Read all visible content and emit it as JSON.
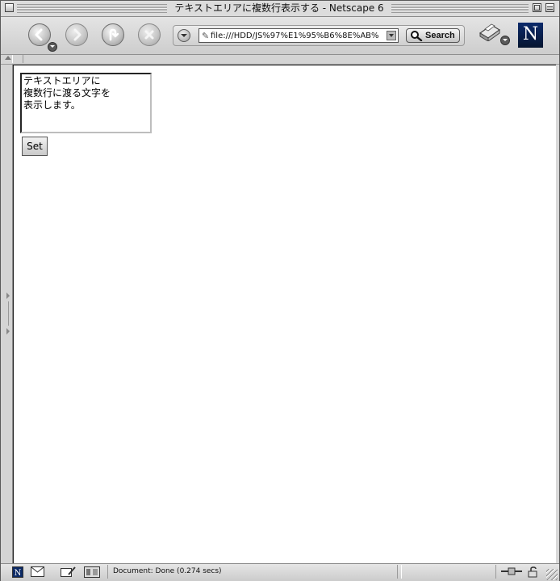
{
  "window": {
    "title": "テキストエリアに複数行表示する - Netscape 6"
  },
  "toolbar": {
    "url_value": "file:///HDD/JS%97%E1%95%B6%8E%AB%",
    "search_label": "Search"
  },
  "logo": {
    "letter": "N"
  },
  "page": {
    "textarea_value": "テキストエリアに\n複数行に渡る文字を\n表示します。",
    "set_button_label": "Set"
  },
  "statusbar": {
    "status_text": "Document: Done (0.274 secs)"
  },
  "icons": {
    "back": "back-arrow-icon",
    "forward": "forward-arrow-icon",
    "reload": "reload-icon",
    "stop": "stop-icon",
    "history": "chevron-down-icon",
    "page": "page-icon",
    "search": "magnifier-icon",
    "print": "print-icon",
    "mail": "mail-icon",
    "composer": "composer-icon",
    "address_book": "address-book-icon",
    "online": "online-status-icon",
    "security": "lock-icon"
  }
}
